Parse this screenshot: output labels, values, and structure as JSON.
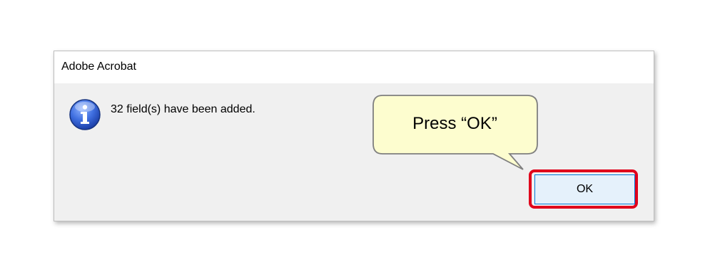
{
  "dialog": {
    "title": "Adobe Acrobat",
    "message": "32 field(s) have been added.",
    "icon": "info-icon",
    "ok_label": "OK"
  },
  "annotation": {
    "callout_text": "Press “OK”",
    "highlight_color": "#e0001b",
    "callout_fill": "#fdfdcf"
  }
}
